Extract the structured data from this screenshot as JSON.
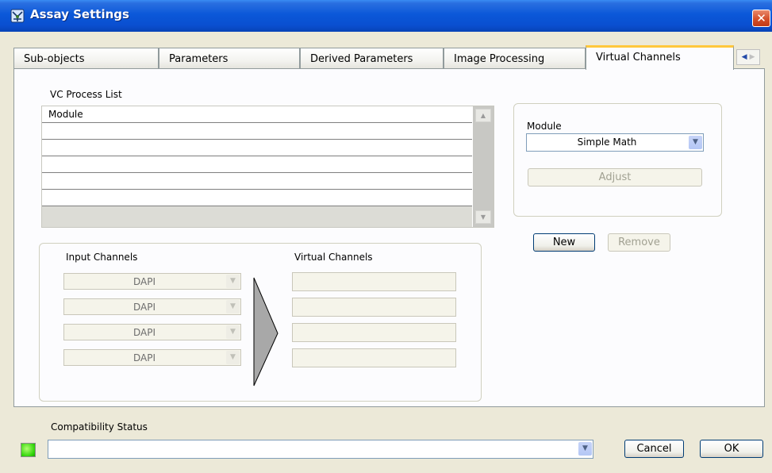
{
  "window": {
    "title": "Assay Settings",
    "close_glyph": "✕"
  },
  "tabs": [
    {
      "label": "Sub-objects",
      "active": false
    },
    {
      "label": "Parameters",
      "active": false
    },
    {
      "label": "Derived Parameters",
      "active": false
    },
    {
      "label": "Image Processing",
      "active": false
    },
    {
      "label": "Virtual Channels",
      "active": true
    }
  ],
  "tab_scroll": {
    "left": "◀",
    "right": "▶"
  },
  "vc_process": {
    "label": "VC Process List",
    "column_header": "Module",
    "rows": [
      "",
      "",
      "",
      "",
      "",
      ""
    ]
  },
  "module_box": {
    "label": "Module",
    "selected": "Simple Math",
    "adjust_label": "Adjust"
  },
  "actions": {
    "new_label": "New",
    "remove_label": "Remove"
  },
  "channels": {
    "input_label": "Input Channels",
    "virtual_label": "Virtual Channels",
    "inputs": [
      "DAPI",
      "DAPI",
      "DAPI",
      "DAPI"
    ],
    "virtual": [
      "",
      "",
      "",
      ""
    ]
  },
  "compatibility": {
    "label": "Compatibility Status",
    "value": ""
  },
  "footer": {
    "cancel_label": "Cancel",
    "ok_label": "OK"
  },
  "icons": {
    "dropdown": "chevron-down-icon",
    "scroll_up": "arrow-up-icon",
    "scroll_down": "arrow-down-icon"
  },
  "colors": {
    "title_blue": "#0b58d9",
    "close_red": "#d44f2a",
    "status_green": "#31d40a",
    "active_tab_accent": "#ffc83c"
  }
}
